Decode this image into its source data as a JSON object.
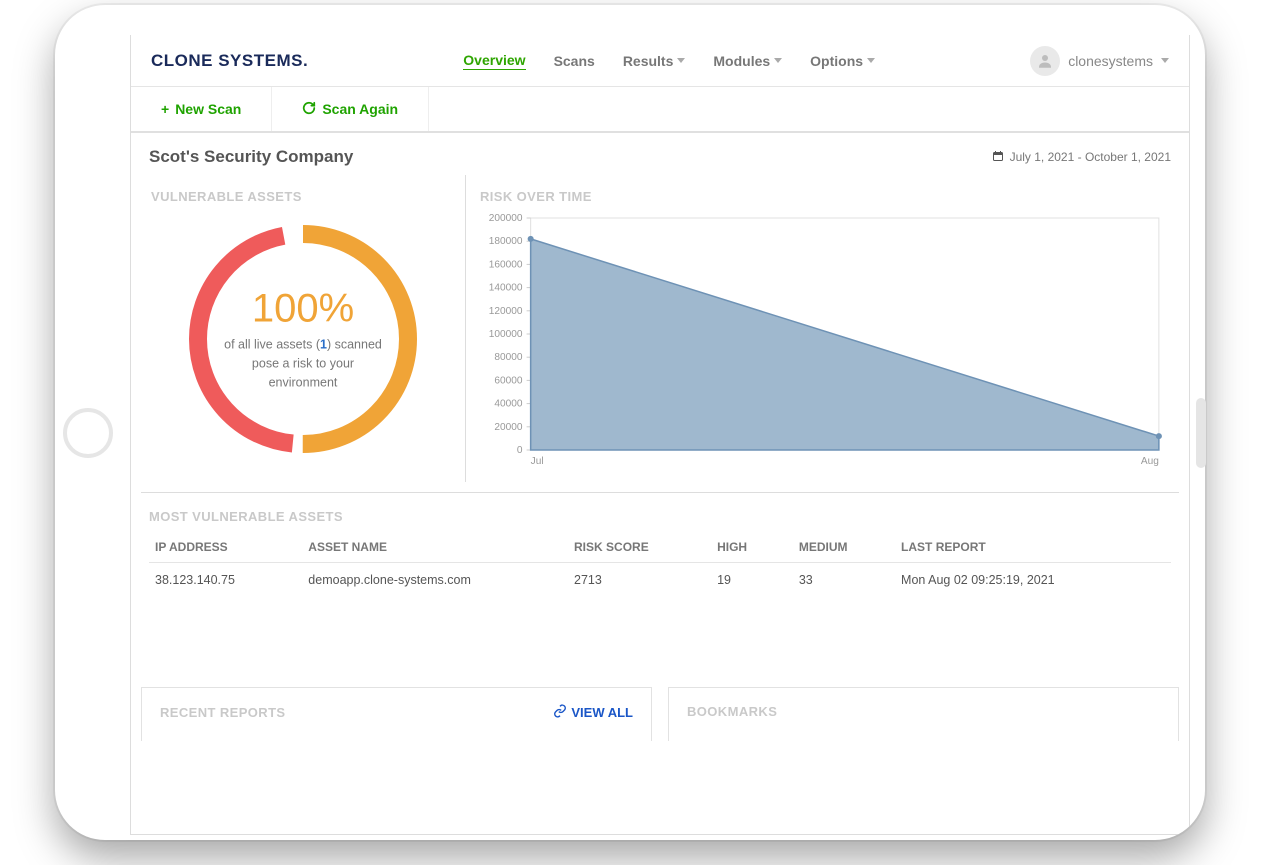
{
  "brand": "CLONE SYSTEMS.",
  "nav": {
    "overview": "Overview",
    "scans": "Scans",
    "results": "Results",
    "modules": "Modules",
    "options": "Options"
  },
  "user": {
    "name": "clonesystems"
  },
  "actions": {
    "new_scan": "New Scan",
    "scan_again": "Scan Again"
  },
  "title": "Scot's Security Company",
  "date_range": "July 1, 2021 - October 1, 2021",
  "vulnerable_assets": {
    "section_title": "VULNERABLE ASSETS",
    "percent": "100%",
    "sub_prefix": "of all live assets (",
    "count": "1",
    "sub_suffix": ") scanned pose a risk to your environment"
  },
  "risk_over_time": {
    "section_title": "RISK OVER TIME"
  },
  "chart_data": {
    "type": "area",
    "x": [
      "Jul",
      "Aug"
    ],
    "values": [
      182000,
      12000
    ],
    "xlabel": "",
    "ylabel": "",
    "ylim": [
      0,
      200000
    ],
    "yticks": [
      0,
      20000,
      40000,
      60000,
      80000,
      100000,
      120000,
      140000,
      160000,
      180000,
      200000
    ]
  },
  "most_vuln": {
    "section_title": "MOST VULNERABLE ASSETS",
    "columns": {
      "ip": "IP ADDRESS",
      "asset": "ASSET NAME",
      "risk": "RISK SCORE",
      "high": "HIGH",
      "medium": "MEDIUM",
      "last_report": "LAST REPORT"
    },
    "rows": [
      {
        "ip": "38.123.140.75",
        "asset": "demoapp.clone-systems.com",
        "risk": "2713",
        "high": "19",
        "medium": "33",
        "last_report": "Mon Aug 02 09:25:19, 2021"
      }
    ]
  },
  "recent_reports": {
    "section_title": "RECENT REPORTS",
    "view_all": "VIEW ALL"
  },
  "bookmarks": {
    "section_title": "BOOKMARKS"
  }
}
